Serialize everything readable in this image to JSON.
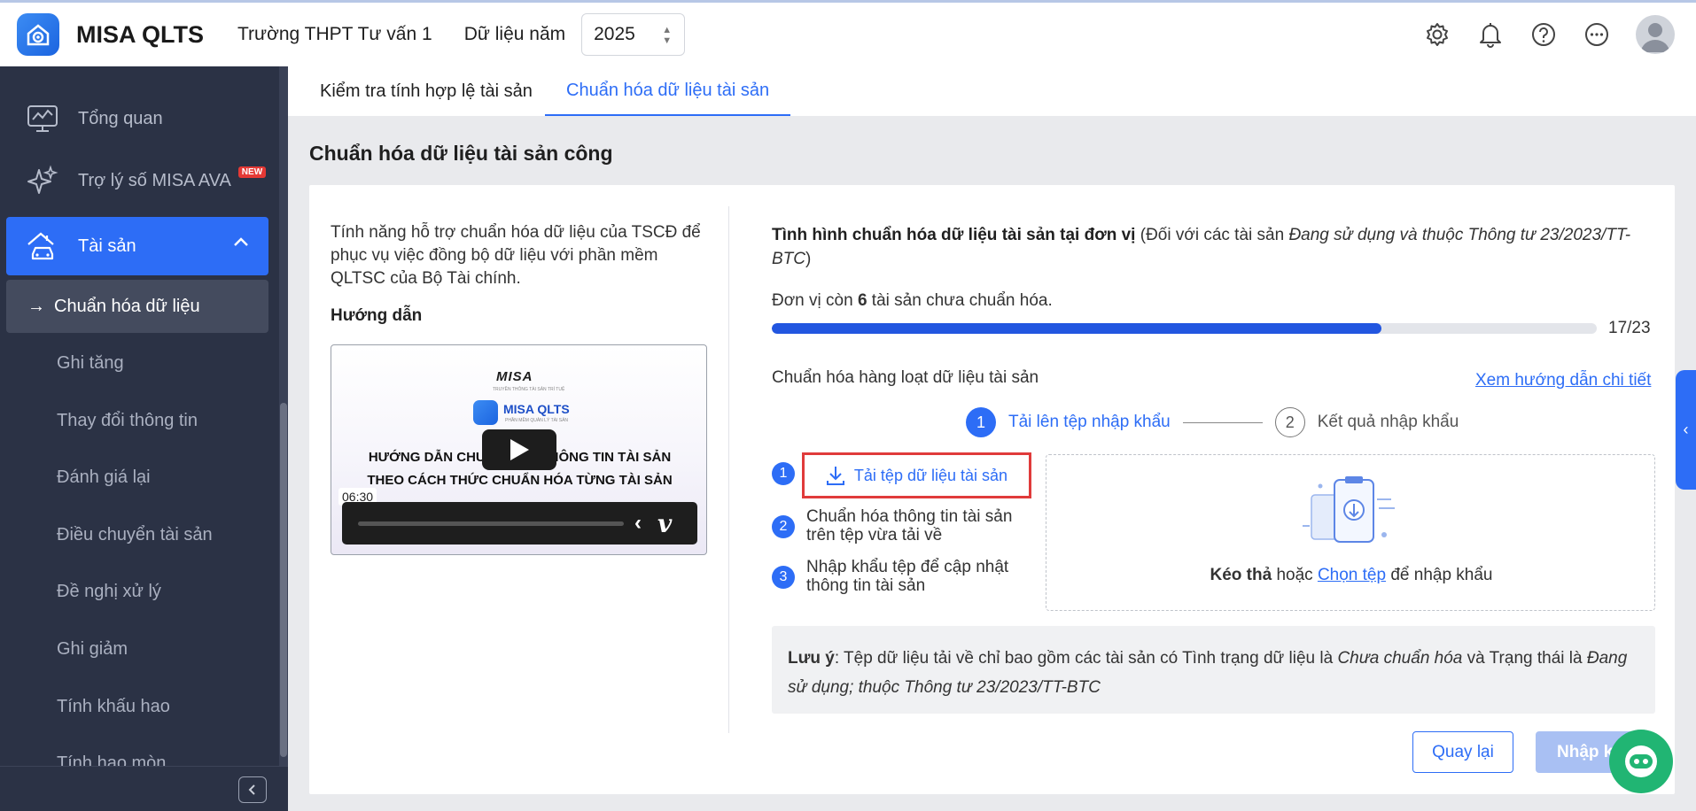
{
  "header": {
    "brand": "MISA QLTS",
    "school": "Trường THPT Tư vấn 1",
    "year_label": "Dữ liệu năm",
    "year_value": "2025",
    "icons": [
      "gear-icon",
      "bell-icon",
      "help-icon",
      "more-icon",
      "avatar-icon"
    ]
  },
  "sidebar": {
    "items": [
      {
        "label": "Tổng quan",
        "icon": "chart-monitor-icon"
      },
      {
        "label": "Trợ lý số MISA AVA",
        "icon": "sparkle-icon",
        "badge": "NEW"
      },
      {
        "label": "Tài sản",
        "icon": "house-car-icon"
      }
    ],
    "subitems": [
      {
        "label": "Chuẩn hóa dữ liệu",
        "prefix": "→"
      },
      {
        "label": "Ghi tăng"
      },
      {
        "label": "Thay đổi thông tin"
      },
      {
        "label": "Đánh giá lại"
      },
      {
        "label": "Điều chuyển tài sản"
      },
      {
        "label": "Đề nghị xử lý"
      },
      {
        "label": "Ghi giảm"
      },
      {
        "label": "Tính khấu hao"
      },
      {
        "label": "Tính hao mòn"
      }
    ]
  },
  "tabs": [
    {
      "label": "Kiểm tra tính hợp lệ tài sản"
    },
    {
      "label": "Chuẩn hóa dữ liệu tài sản"
    }
  ],
  "page_title": "Chuẩn hóa dữ liệu tài sản công",
  "left": {
    "intro": "Tính năng hỗ trợ chuẩn hóa dữ liệu của TSCĐ để phục vụ việc đồng bộ dữ liệu với phần mềm QLTSC của Bộ Tài chính.",
    "guide_label": "Hướng dẫn",
    "video": {
      "misa": "MISA",
      "misa_sub": "TRUYỀN THÔNG TÀI SẢN TRÍ TUỆ",
      "qlts": "MISA QLTS",
      "qlts_sub": "PHẦN MỀM QUẢN LÝ TÀI SẢN",
      "line1": "HƯỚNG DẪN CHUẨN HÓA THÔNG TIN TÀI SẢN",
      "line2": "THEO CÁCH THỨC CHUẨN HÓA TỪNG TÀI SẢN",
      "time": "06:30"
    }
  },
  "right": {
    "status_bold": "Tình hình chuẩn hóa dữ liệu tài sản tại đơn vị",
    "status_paren_open": " (Đối với các tài sản ",
    "status_italic": "Đang sử dụng và thuộc Thông tư 23/2023/TT-BTC",
    "status_paren_close": ")",
    "remain_pre": "Đơn vị còn ",
    "remain_count": "6",
    "remain_post": " tài sản chưa chuẩn hóa.",
    "progress": {
      "done": 17,
      "total": 23,
      "label": "17/23"
    },
    "batch_title": "Chuẩn hóa hàng loạt dữ liệu tài sản",
    "detail_link": "Xem hướng dẫn chi tiết",
    "stepper": [
      {
        "num": "1",
        "label": "Tải lên tệp nhập khẩu"
      },
      {
        "num": "2",
        "label": "Kết quả nhập khẩu"
      }
    ],
    "steps": [
      {
        "num": "1",
        "label": "Tải tệp dữ liệu tài sản"
      },
      {
        "num": "2",
        "label": "Chuẩn hóa thông tin tài sản trên tệp vừa tải về"
      },
      {
        "num": "3",
        "label": "Nhập khẩu tệp để cập nhật thông tin tài sản"
      }
    ],
    "dropzone": {
      "drag": "Kéo thả",
      "or": " hoặc ",
      "choose": "Chọn tệp",
      "suffix": " để nhập khẩu"
    },
    "note": {
      "label": "Lưu ý",
      "t1": ": Tệp dữ liệu tải về chỉ bao gồm các tài sản có Tình trạng dữ liệu là ",
      "i1": "Chưa chuẩn hóa",
      "t2": " và Trạng thái là ",
      "i2": "Đang sử dụng; thuộc Thông tư 23/2023/TT-BTC"
    },
    "buttons": {
      "back": "Quay lại",
      "import": "Nhập khẩu"
    }
  },
  "colors": {
    "primary": "#2d6df6",
    "sidebar": "#2b3245",
    "highlight": "#e03b3b",
    "chat": "#21b573"
  }
}
